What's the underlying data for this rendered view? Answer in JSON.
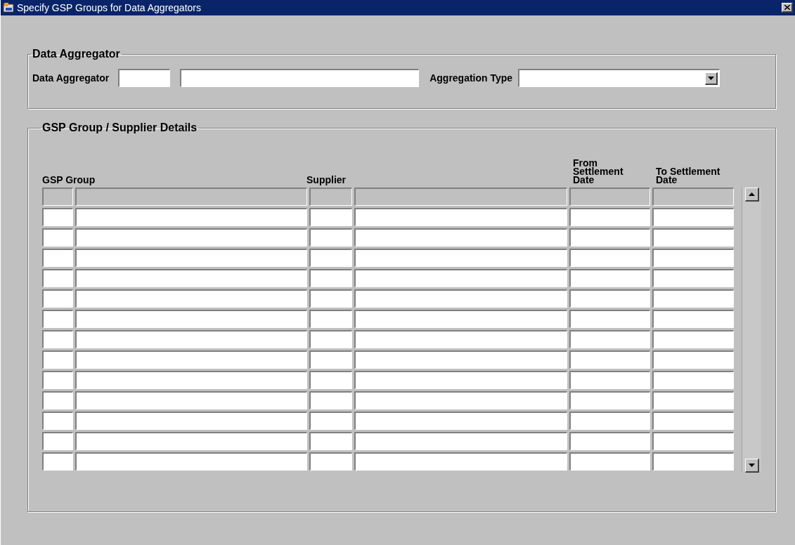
{
  "window": {
    "title": "Specify GSP Groups for Data Aggregators"
  },
  "data_aggregator_group": {
    "legend": "Data Aggregator",
    "field_label": "Data Aggregator",
    "aggregation_type_label": "Aggregation Type"
  },
  "details_group": {
    "legend": "GSP Group / Supplier Details",
    "columns": [
      "GSP Group",
      "Supplier",
      "From Settlement Date",
      "To Settlement Date"
    ],
    "rows": [
      {
        "disabled": true
      },
      {
        "disabled": false
      },
      {
        "disabled": false
      },
      {
        "disabled": false
      },
      {
        "disabled": false
      },
      {
        "disabled": false
      },
      {
        "disabled": false
      },
      {
        "disabled": false
      },
      {
        "disabled": false
      },
      {
        "disabled": false
      },
      {
        "disabled": false
      },
      {
        "disabled": false
      },
      {
        "disabled": false
      },
      {
        "disabled": false
      }
    ]
  }
}
